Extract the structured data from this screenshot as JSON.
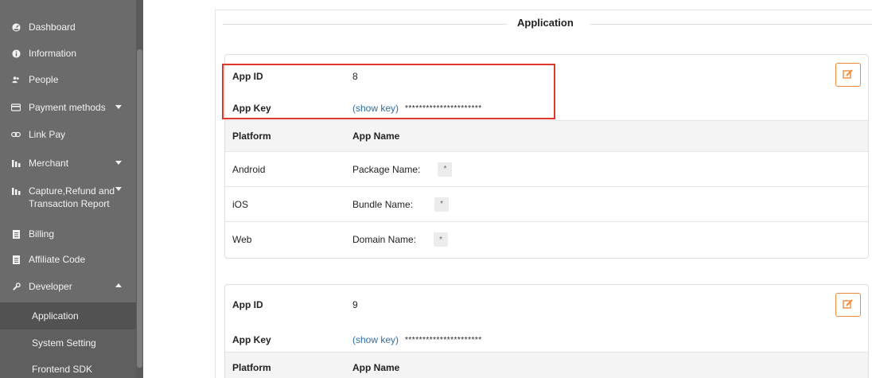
{
  "sidebar": {
    "items": [
      {
        "label": "Dashboard",
        "icon": "gauge-icon"
      },
      {
        "label": "Information",
        "icon": "info-icon"
      },
      {
        "label": "People",
        "icon": "people-icon"
      },
      {
        "label": "Payment methods",
        "icon": "card-icon"
      },
      {
        "label": "Link Pay",
        "icon": "link-icon"
      },
      {
        "label": "Merchant",
        "icon": "chart-icon"
      },
      {
        "label": "Capture,Refund and",
        "label2": "Transaction Report",
        "icon": "chart-icon"
      },
      {
        "label": "Billing",
        "icon": "document-icon"
      },
      {
        "label": "Affiliate Code",
        "icon": "document-icon"
      },
      {
        "label": "Developer",
        "icon": "wrench-icon"
      }
    ],
    "sub_items": [
      {
        "label": "Application",
        "active": true
      },
      {
        "label": "System Setting",
        "active": false
      },
      {
        "label": "Frontend SDK",
        "active": false
      }
    ]
  },
  "section": {
    "title": "Application"
  },
  "apps": [
    {
      "app_id_label": "App ID",
      "app_id": "8",
      "app_key_label": "App Key",
      "show_key": "(show key)",
      "app_key_masked": "**********************",
      "platform_header": "Platform",
      "app_name_header": "App Name",
      "platforms": [
        {
          "platform": "Android",
          "name_label": "Package Name:",
          "value": "*"
        },
        {
          "platform": "iOS",
          "name_label": "Bundle Name:",
          "value": "*"
        },
        {
          "platform": "Web",
          "name_label": "Domain Name:",
          "value": "*"
        }
      ]
    },
    {
      "app_id_label": "App ID",
      "app_id": "9",
      "app_key_label": "App Key",
      "show_key": "(show key)",
      "app_key_masked": "**********************",
      "platform_header": "Platform",
      "app_name_header": "App Name"
    }
  ],
  "colors": {
    "sidebar_bg": "#6b6b6b",
    "accent_orange": "#ef8a3a",
    "link_blue": "#2e6da4",
    "highlight_red": "#e0392b"
  }
}
